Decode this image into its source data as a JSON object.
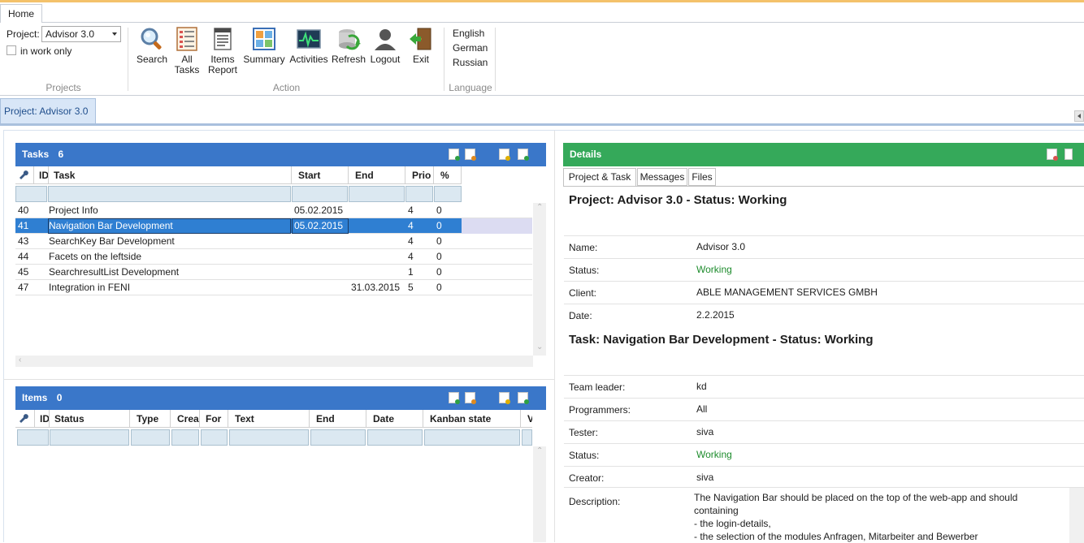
{
  "ribbon": {
    "home_tab": "Home",
    "projects_group": {
      "project_label": "Project:",
      "project_value": "Advisor 3.0",
      "in_work_only_label": "in work only",
      "in_work_only_checked": false,
      "group_label": "Projects"
    },
    "action_group": {
      "buttons": {
        "search": "Search",
        "all_tasks_1": "All",
        "all_tasks_2": "Tasks",
        "items_report_1": "Items",
        "items_report_2": "Report",
        "summary": "Summary",
        "activities": "Activities",
        "refresh": "Refresh",
        "logout": "Logout",
        "exit": "Exit"
      },
      "icons": {
        "search": "magnifier-icon",
        "all_tasks": "task-list-icon",
        "items_report": "report-icon",
        "summary": "summary-grid-icon",
        "activities": "activity-monitor-icon",
        "refresh": "refresh-icon",
        "logout": "user-icon",
        "exit": "exit-door-icon"
      },
      "group_label": "Action"
    },
    "language_group": {
      "languages": [
        "English",
        "German",
        "Russian"
      ],
      "group_label": "Language"
    }
  },
  "document_tab": "Project: Advisor 3.0",
  "tasks_panel": {
    "title": "Tasks",
    "count": "6",
    "columns": [
      "ID",
      "Task",
      "Start",
      "End",
      "Prio",
      "%"
    ],
    "rows": [
      {
        "id": "40",
        "task": "Project Info",
        "start": "05.02.2015",
        "end": "",
        "prio": "4",
        "pct": "0"
      },
      {
        "id": "41",
        "task": "Navigation Bar Development",
        "start": "05.02.2015",
        "end": "",
        "prio": "4",
        "pct": "0",
        "selected": true
      },
      {
        "id": "43",
        "task": "SearchKey Bar Development",
        "start": "",
        "end": "",
        "prio": "4",
        "pct": "0"
      },
      {
        "id": "44",
        "task": "Facets on the leftside",
        "start": "",
        "end": "",
        "prio": "4",
        "pct": "0"
      },
      {
        "id": "45",
        "task": "SearchresultList Development",
        "start": "",
        "end": "",
        "prio": "1",
        "pct": "0"
      },
      {
        "id": "47",
        "task": "Integration in FENI",
        "start": "",
        "end": "31.03.2015",
        "prio": "5",
        "pct": "0"
      }
    ]
  },
  "items_panel": {
    "title": "Items",
    "count": "0",
    "columns": [
      "ID",
      "Status",
      "Type",
      "Crea",
      "For",
      "Text",
      "End",
      "Date",
      "Kanban state",
      "V"
    ]
  },
  "details_panel": {
    "title": "Details",
    "tabs": [
      "Project & Task",
      "Messages",
      "Files"
    ],
    "project_heading": "Project: Advisor 3.0 - Status: Working",
    "project_fields": [
      {
        "label": "Name:",
        "value": "Advisor 3.0",
        "status": false
      },
      {
        "label": "Status:",
        "value": "Working",
        "status": true
      },
      {
        "label": "Client:",
        "value": "ABLE MANAGEMENT SERVICES GMBH",
        "status": false
      },
      {
        "label": "Date:",
        "value": "2.2.2015",
        "status": false
      }
    ],
    "task_heading": "Task: Navigation Bar Development - Status: Working",
    "task_fields": [
      {
        "label": "Team leader:",
        "value": "kd",
        "status": false
      },
      {
        "label": "Programmers:",
        "value": "All",
        "status": false
      },
      {
        "label": "Tester:",
        "value": "siva",
        "status": false
      },
      {
        "label": "Status:",
        "value": "Working",
        "status": true
      },
      {
        "label": "Creator:",
        "value": "siva",
        "status": false
      }
    ],
    "description_label": "Description:",
    "description_lines": [
      "The Navigation Bar should be placed on the top of the web-app and should",
      "containing",
      "- the login-details,",
      "- the selection of the modules Anfragen, Mitarbeiter and Bewerber"
    ]
  },
  "colors": {
    "tasks_header": "#3a77c9",
    "details_header": "#35a95a",
    "selected_row": "#2f7fd2",
    "status_working": "#1e8c2d"
  }
}
